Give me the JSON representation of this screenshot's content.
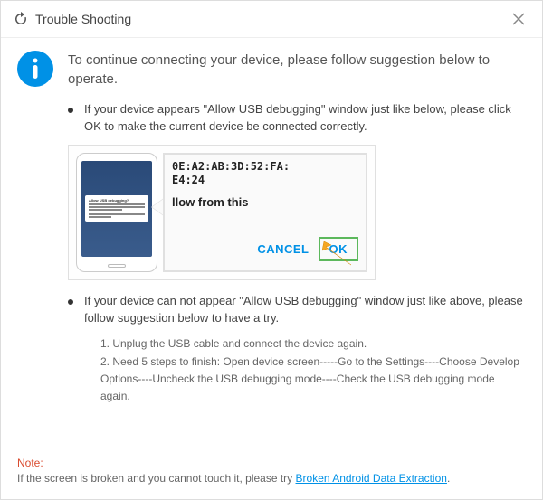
{
  "titlebar": {
    "title": "Trouble Shooting"
  },
  "heading": "To continue connecting your device, please follow suggestion below to operate.",
  "item1": {
    "text": "If your device appears \"Allow USB debugging\" window just like below, please click OK to make the current device  be connected correctly."
  },
  "illustration": {
    "popup_title": "Allow USB debugging?",
    "mac1": "0E:A2:AB:3D:52:FA:",
    "mac2": "E4:24",
    "prompt": "llow from this",
    "cancel": "CANCEL",
    "ok": "OK"
  },
  "item2": {
    "text": "If your device can not appear \"Allow USB debugging\" window just like above, please follow suggestion below to have a try.",
    "step1": "1. Unplug the USB cable and connect the device again.",
    "step2": "2. Need 5 steps to finish: Open device screen-----Go to the Settings----Choose Develop Options----Uncheck the USB debugging mode----Check the USB debugging mode again."
  },
  "footer": {
    "note_label": "Note:",
    "note_text": "If the screen is broken and you cannot touch it, please try ",
    "link": "Broken Android Data Extraction",
    "period": "."
  }
}
